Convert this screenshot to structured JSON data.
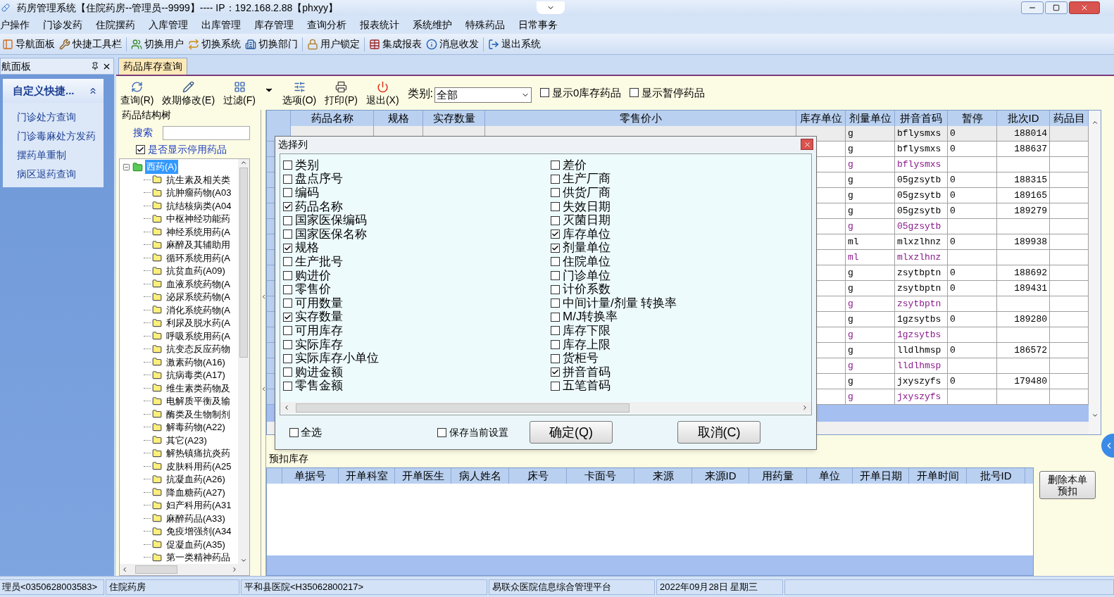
{
  "window": {
    "title": "药房管理系统【住院药房--管理员--9999】---- IP：192.168.2.88【phxyy】"
  },
  "menu": [
    "户操作",
    "门诊发药",
    "住院摆药",
    "入库管理",
    "出库管理",
    "库存管理",
    "查询分析",
    "报表统计",
    "系统维护",
    "特殊药品",
    "日常事务"
  ],
  "toolbar": [
    "导航面板",
    "快捷工具栏",
    "切换用户",
    "切换系统",
    "切换部门",
    "用户锁定",
    "集成报表",
    "消息收发",
    "退出系统"
  ],
  "nav_panel": {
    "title": "航面板",
    "section": "自定义快捷...",
    "expanded": true,
    "items": [
      "门诊处方查询",
      "门诊毒麻处方发药",
      "摆药单重制",
      "病区退药查询"
    ]
  },
  "tabs": [
    {
      "label": "药品库存查询",
      "selected": true
    }
  ],
  "actions": [
    "查询(R)",
    "效期修改(E)",
    "过滤(F)",
    "选项(O)",
    "打印(P)",
    "退出(X)"
  ],
  "filter": {
    "label": "类别:",
    "value": "全部",
    "options": [
      {
        "label": "显示0库存药品",
        "checked": false
      },
      {
        "label": "显示暂停药品",
        "checked": false
      }
    ]
  },
  "tree_panel": {
    "title": "药品结构树",
    "search_label": "搜索",
    "show_disabled": {
      "label": "是否显示停用药品",
      "checked": true
    },
    "tree": [
      {
        "label": "西药(A)",
        "selected": true,
        "expanded": true,
        "children": [
          {
            "label": "抗生素及相关类",
            "selected": false
          },
          {
            "label": "抗肿瘤药物(A03",
            "selected": false
          },
          {
            "label": "抗结核病类(A04",
            "selected": false
          },
          {
            "label": "中枢神经功能药",
            "selected": false
          },
          {
            "label": "神经系统用药(A",
            "selected": false
          },
          {
            "label": "麻醉及其辅助用",
            "selected": false
          },
          {
            "label": "循环系统用药(A",
            "selected": false
          },
          {
            "label": "抗贫血药(A09)",
            "selected": false
          },
          {
            "label": "血液系统药物(A",
            "selected": false
          },
          {
            "label": "泌尿系统药物(A",
            "selected": false
          },
          {
            "label": "消化系统药物(A",
            "selected": false
          },
          {
            "label": "利尿及脱水药(A",
            "selected": false
          },
          {
            "label": "呼吸系统用药(A",
            "selected": false
          },
          {
            "label": "抗变态反应药物",
            "selected": false
          },
          {
            "label": "激素药物(A16)",
            "selected": false
          },
          {
            "label": "抗病毒类(A17)",
            "selected": false
          },
          {
            "label": "维生素类药物及",
            "selected": false
          },
          {
            "label": "电解质平衡及输",
            "selected": false
          },
          {
            "label": "酶类及生物制剂",
            "selected": false
          },
          {
            "label": "解毒药物(A22)",
            "selected": false
          },
          {
            "label": "其它(A23)",
            "selected": false
          },
          {
            "label": "解热镇痛抗炎药",
            "selected": false
          },
          {
            "label": "皮肤科用药(A25",
            "selected": false
          },
          {
            "label": "抗凝血药(A26)",
            "selected": false
          },
          {
            "label": "降血糖药(A27)",
            "selected": false
          },
          {
            "label": "妇产科用药(A31",
            "selected": false
          },
          {
            "label": "麻醉药品(A33)",
            "selected": false
          },
          {
            "label": "免疫增强剂(A34",
            "selected": false
          },
          {
            "label": "促凝血药(A35)",
            "selected": false
          },
          {
            "label": "第一类精神药品",
            "selected": false
          }
        ]
      }
    ]
  },
  "grid": {
    "columns": [
      "药品名称",
      "规格",
      "实存数量",
      "零售价小",
      "库存单位",
      "剂量单位",
      "拼音首码",
      "暂停",
      "批次ID",
      "药品目"
    ],
    "rows": [
      {
        "kind": "detail",
        "dose_unit": "g",
        "pinyin": "bflysmxs",
        "paused": "0",
        "batch_id": "188014"
      },
      {
        "kind": "detail",
        "dose_unit": "g",
        "pinyin": "bflysmxs",
        "paused": "0",
        "batch_id": "188637"
      },
      {
        "kind": "subtotal",
        "dose_unit": "g",
        "pinyin": "bflysmxs"
      },
      {
        "kind": "detail",
        "dose_unit": "g",
        "pinyin": "05gzsytb",
        "paused": "0",
        "batch_id": "188315"
      },
      {
        "kind": "detail",
        "dose_unit": "g",
        "pinyin": "05gzsytb",
        "paused": "0",
        "batch_id": "189165"
      },
      {
        "kind": "detail",
        "dose_unit": "g",
        "pinyin": "05gzsytb",
        "paused": "0",
        "batch_id": "189279"
      },
      {
        "kind": "subtotal",
        "dose_unit": "g",
        "pinyin": "05gzsytb"
      },
      {
        "kind": "detail",
        "dose_unit": "ml",
        "pinyin": "mlxzlhnz",
        "paused": "0",
        "batch_id": "189938"
      },
      {
        "kind": "subtotal",
        "dose_unit": "ml",
        "pinyin": "mlxzlhnz"
      },
      {
        "kind": "detail",
        "dose_unit": "g",
        "pinyin": "zsytbptn",
        "paused": "0",
        "batch_id": "188692"
      },
      {
        "kind": "detail",
        "dose_unit": "g",
        "pinyin": "zsytbptn",
        "paused": "0",
        "batch_id": "189431"
      },
      {
        "kind": "subtotal",
        "dose_unit": "g",
        "pinyin": "zsytbptn"
      },
      {
        "kind": "detail",
        "dose_unit": "g",
        "pinyin": "1gzsytbs",
        "paused": "0",
        "batch_id": "189280"
      },
      {
        "kind": "subtotal",
        "dose_unit": "g",
        "pinyin": "1gzsytbs"
      },
      {
        "kind": "detail",
        "dose_unit": "g",
        "pinyin": "lldlhmsp",
        "paused": "0",
        "batch_id": "186572"
      },
      {
        "kind": "subtotal",
        "dose_unit": "g",
        "pinyin": "lldlhmsp"
      },
      {
        "kind": "detail",
        "dose_unit": "g",
        "pinyin": "jxyszyfs",
        "paused": "0",
        "batch_id": "179480"
      },
      {
        "kind": "subtotal",
        "dose_unit": "g",
        "pinyin": "jxyszyfs"
      }
    ]
  },
  "dialog": {
    "title": "选择列",
    "column_items": [
      [
        {
          "label": "类别",
          "checked": false
        },
        {
          "label": "盘点序号",
          "checked": false
        },
        {
          "label": "编码",
          "checked": false
        },
        {
          "label": "药品名称",
          "checked": true
        },
        {
          "label": "国家医保编码",
          "checked": false
        },
        {
          "label": "国家医保名称",
          "checked": false
        },
        {
          "label": "规格",
          "checked": true
        },
        {
          "label": "生产批号",
          "checked": false
        },
        {
          "label": "购进价",
          "checked": false
        },
        {
          "label": "零售价",
          "checked": false
        },
        {
          "label": "可用数量",
          "checked": false
        },
        {
          "label": "实存数量",
          "checked": true
        },
        {
          "label": "可用库存",
          "checked": false
        },
        {
          "label": "实际库存",
          "checked": false
        },
        {
          "label": "实际库存小单位",
          "checked": false
        },
        {
          "label": "购进金额",
          "checked": false
        },
        {
          "label": "零售金额",
          "checked": false
        }
      ],
      [
        {
          "label": "差价",
          "checked": false
        },
        {
          "label": "生产厂商",
          "checked": false
        },
        {
          "label": "供货厂商",
          "checked": false
        },
        {
          "label": "失效日期",
          "checked": false
        },
        {
          "label": "灭菌日期",
          "checked": false
        },
        {
          "label": "库存单位",
          "checked": true
        },
        {
          "label": "剂量单位",
          "checked": true
        },
        {
          "label": "住院单位",
          "checked": false
        },
        {
          "label": "门诊单位",
          "checked": false
        },
        {
          "label": "计价系数",
          "checked": false
        },
        {
          "label": "中间计量/剂量 转换率",
          "checked": false
        },
        {
          "label": "M/J转换率",
          "checked": false
        },
        {
          "label": "库存下限",
          "checked": false
        },
        {
          "label": "库存上限",
          "checked": false
        },
        {
          "label": "货柜号",
          "checked": false
        },
        {
          "label": "拼音首码",
          "checked": true
        },
        {
          "label": "五笔首码",
          "checked": false
        }
      ]
    ],
    "select_all": {
      "label": "全选",
      "checked": false
    },
    "save_settings": {
      "label": "保存当前设置",
      "checked": false
    },
    "buttons": [
      "确定(Q)",
      "取消(C)"
    ]
  },
  "lower": {
    "label": "预扣库存",
    "columns": [
      "单据号",
      "开单科室",
      "开单医生",
      "病人姓名",
      "床号",
      "卡面号",
      "来源",
      "来源ID",
      "用药量",
      "单位",
      "开单日期",
      "开单时间",
      "批号ID"
    ],
    "button": "删除本单预扣"
  },
  "status_bar": [
    "理员<0350628003583>",
    "住院药房",
    "平和县医院<H35062800217>",
    "易联众医院信息综合管理平台",
    "2022年09月28日 星期三"
  ]
}
